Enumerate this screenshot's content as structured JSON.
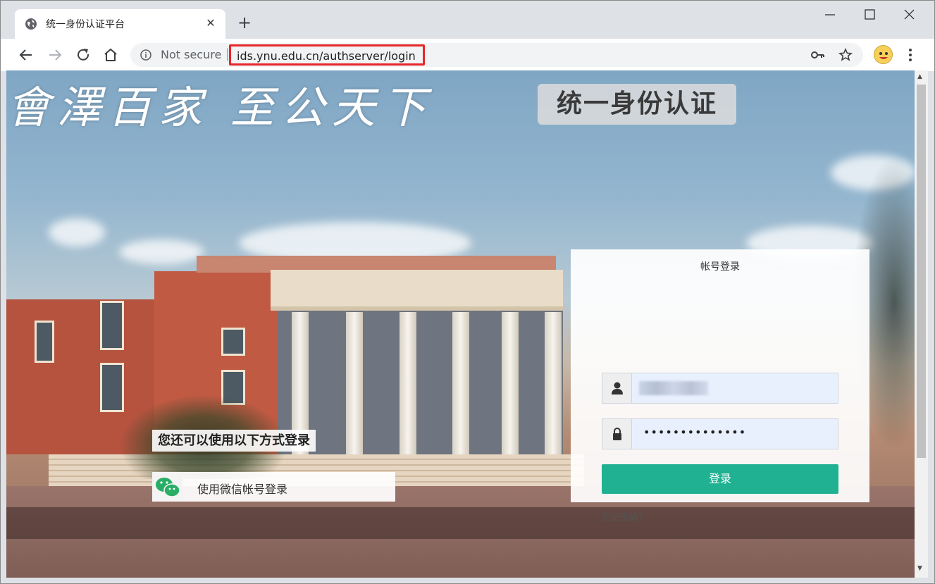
{
  "browser": {
    "tab_title": "统一身份认证平台",
    "security_label": "Not secure",
    "url": "ids.ynu.edu.cn/authserver/login"
  },
  "banner": {
    "slogan": "會澤百家  至公天下",
    "badge": "统一身份认证"
  },
  "login": {
    "panel_title": "帐号登录",
    "password_mask": "••••••••••••••",
    "submit_label": "登录",
    "forgot_label": "忘记密码?"
  },
  "alt_login": {
    "title": "您还可以使用以下方式登录",
    "wechat_label": "使用微信帐号登录"
  },
  "colors": {
    "login_button": "#1fb191",
    "url_highlight": "#e8262a",
    "wechat_green": "#2aae67"
  }
}
